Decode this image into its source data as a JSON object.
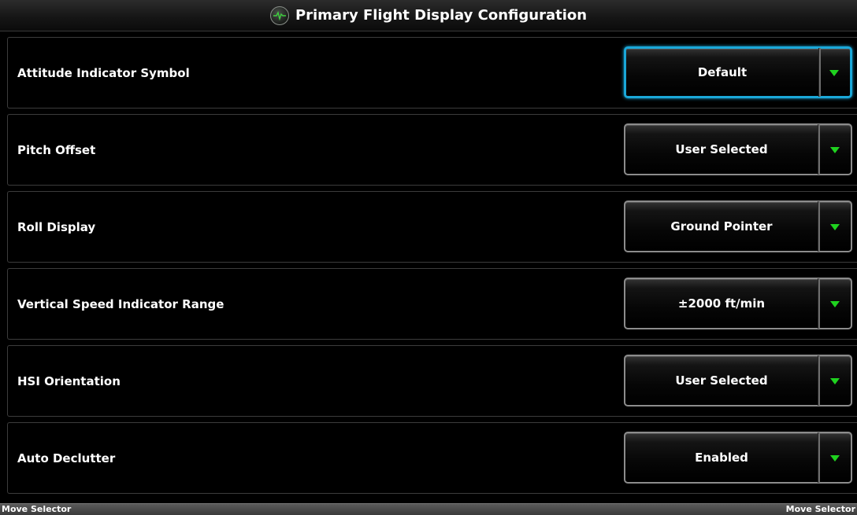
{
  "header": {
    "title": "Primary Flight Display Configuration",
    "icon": "pfd-app-icon"
  },
  "settings": [
    {
      "label": "Attitude Indicator Symbol",
      "value": "Default",
      "focused": true
    },
    {
      "label": "Pitch Offset",
      "value": "User Selected",
      "focused": false
    },
    {
      "label": "Roll Display",
      "value": "Ground Pointer",
      "focused": false
    },
    {
      "label": "Vertical Speed Indicator Range",
      "value": "±2000 ft/min",
      "focused": false
    },
    {
      "label": "HSI Orientation",
      "value": "User Selected",
      "focused": false
    },
    {
      "label": "Auto Declutter",
      "value": "Enabled",
      "focused": false
    }
  ],
  "softkeys": {
    "left": "Move Selector",
    "right": "Move Selector"
  },
  "colors": {
    "focus": "#1aa7d8",
    "arrow": "#1fd21f",
    "background": "#000000"
  }
}
